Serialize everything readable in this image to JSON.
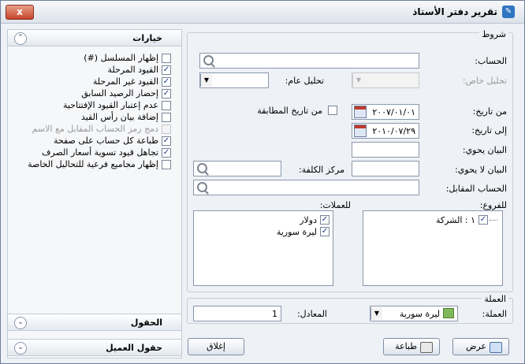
{
  "window": {
    "title": "تقرير دفتر الأستاذ",
    "close_label": "x"
  },
  "conditions": {
    "group_label": "شروط",
    "account_label": "الحساب:",
    "account_value": "",
    "special_analysis_label": "تحليل خاص:",
    "general_analysis_label": "تحليل عام:",
    "from_date_label": "من تاريخ:",
    "from_date_value": "٢٠٠٧/٠١/٠١",
    "match_date_label": "من تاريخ المطابقة",
    "to_date_label": "إلى تاريخ:",
    "to_date_value": "٢٠١٠/٠٧/٢٩",
    "statement_contains_label": "البيان يحوي:",
    "statement_not_contains_label": "البيان لا يحوي:",
    "cost_center_label": "مركز الكلفة:",
    "counter_account_label": "الحساب المقابل:",
    "branches_label": "للفروع:",
    "currencies_label": "للعملات:",
    "branches": [
      {
        "label": "١ : الشركة",
        "checked": true
      }
    ],
    "currencies": [
      {
        "label": "دولار",
        "checked": true
      },
      {
        "label": "ليرة سورية",
        "checked": true
      }
    ]
  },
  "currency_section": {
    "group_label": "العملة",
    "currency_label": "العملة:",
    "currency_value": "ليرة سورية",
    "equivalent_label": "المعادل:",
    "equivalent_value": "1"
  },
  "buttons": {
    "view": "عرض",
    "print": "طباعة",
    "close": "إغلاق"
  },
  "options_panel": {
    "title": "خيارات",
    "items": [
      {
        "label": "إظهار المسلسل (#)",
        "checked": false,
        "enabled": true
      },
      {
        "label": "القيود المرحلة",
        "checked": true,
        "enabled": true
      },
      {
        "label": "القيود غير المرحلة",
        "checked": true,
        "enabled": true
      },
      {
        "label": "إحضار الرصيد السابق",
        "checked": true,
        "enabled": true
      },
      {
        "label": "عدم إعتبار القيود الإفتتاحية",
        "checked": false,
        "enabled": true
      },
      {
        "label": "إضافة بيان رأس القيد",
        "checked": false,
        "enabled": true
      },
      {
        "label": "دمج رمز الحساب المقابل مع الاسم",
        "checked": false,
        "enabled": false
      },
      {
        "label": "طباعة كل حساب على صفحة",
        "checked": true,
        "enabled": true
      },
      {
        "label": "تجاهل قيود تسوية أسعار الصرف",
        "checked": true,
        "enabled": true
      },
      {
        "label": "إظهار مجاميع فرعية للتحاليل الخاصة",
        "checked": false,
        "enabled": true
      }
    ]
  },
  "fields_panel": {
    "title": "الحقول"
  },
  "custom_fields_panel": {
    "title": "حقول العميل"
  }
}
